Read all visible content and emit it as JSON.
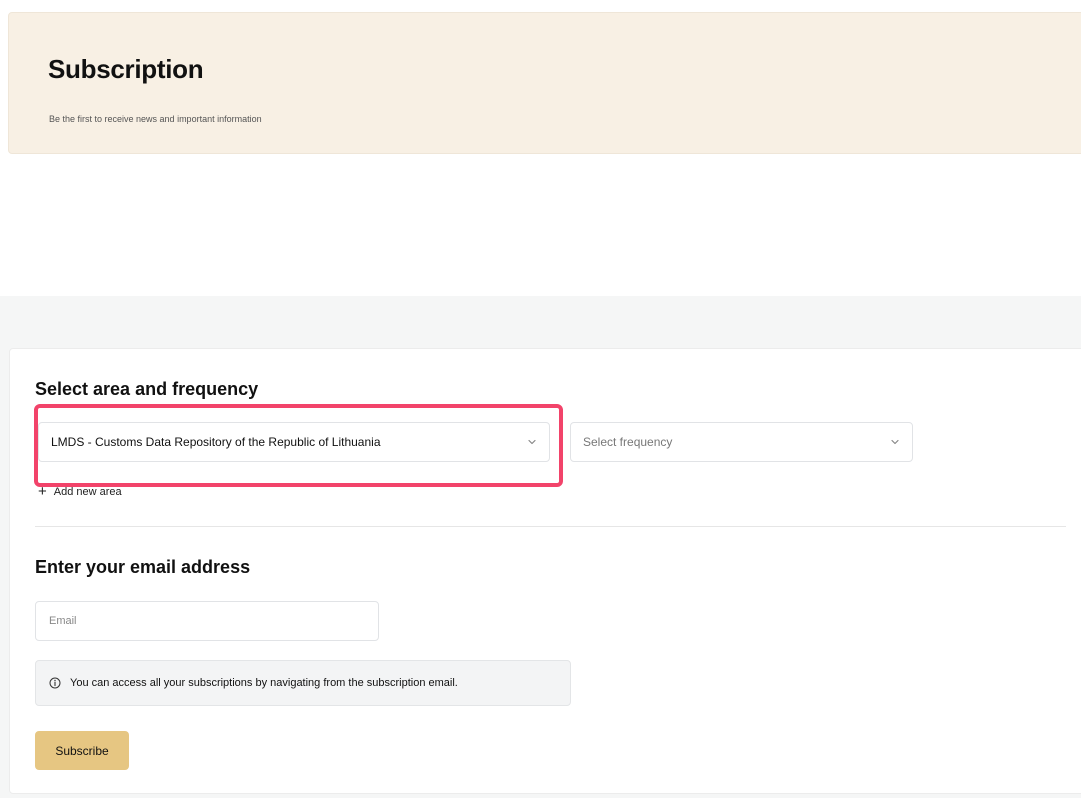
{
  "hero": {
    "title": "Subscription",
    "subtitle": "Be the first to receive news and important information"
  },
  "area_section": {
    "heading": "Select area and frequency",
    "area_select": {
      "value": "LMDS - Customs Data Repository of the Republic of Lithuania",
      "icon": "chevron-down-icon"
    },
    "frequency_select": {
      "placeholder": "Select frequency",
      "icon": "chevron-down-icon"
    },
    "add_area_label": "Add new area",
    "add_area_icon": "plus-icon"
  },
  "email_section": {
    "heading": "Enter your email address",
    "email_placeholder": "Email",
    "email_value": "",
    "info_icon": "info-icon",
    "info_text": "You can access all your subscriptions by navigating from the subscription email."
  },
  "actions": {
    "subscribe_label": "Subscribe"
  },
  "colors": {
    "hero_background": "#f8f0e4",
    "section_background": "#f5f6f6",
    "button_accent": "#e6c682",
    "highlight": "#f2436a"
  }
}
